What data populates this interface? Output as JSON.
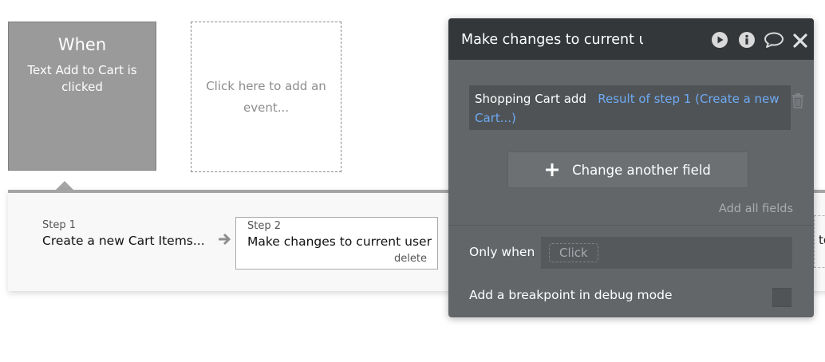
{
  "events": {
    "when_title": "When",
    "when_description": "Text Add to Cart is clicked",
    "add_event_label": "Click here to add an event..."
  },
  "steps": [
    {
      "label": "Step 1",
      "title": "Create a new Cart Items..."
    },
    {
      "label": "Step 2",
      "title": "Make changes to current user",
      "delete_label": "delete"
    }
  ],
  "strip_overflow_text": "to",
  "panel": {
    "title": "Make changes to current user",
    "icons": [
      "play-icon",
      "info-icon",
      "comment-icon",
      "close-icon"
    ],
    "field_row": {
      "name": "Shopping Cart add",
      "value": "Result of step 1 (Create a new Cart...)"
    },
    "change_button_label": "Change another field",
    "add_all_fields_label": "Add all fields",
    "only_when_label": "Only when",
    "only_when_placeholder": "Click",
    "breakpoint_label": "Add a breakpoint in debug mode"
  },
  "colors": {
    "panel_bg": "#626669",
    "panel_header_bg": "#33373a",
    "link_blue": "#6eaaf3",
    "when_card_bg": "#9a9a9a"
  }
}
